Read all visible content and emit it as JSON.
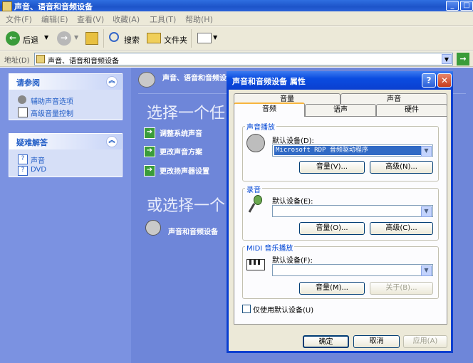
{
  "window": {
    "title": "声音、语音和音频设备"
  },
  "menu": [
    "文件(F)",
    "编辑(E)",
    "查看(V)",
    "收藏(A)",
    "工具(T)",
    "帮助(H)"
  ],
  "toolbar": {
    "back": "后退",
    "search": "搜索",
    "folders": "文件夹"
  },
  "address": {
    "label": "地址(D)",
    "value": "声音、语音和音频设备",
    "go": "→"
  },
  "see_also": {
    "title": "请参阅",
    "items": [
      "辅助声音选项",
      "高级音量控制"
    ]
  },
  "troubleshoot": {
    "title": "疑难解答",
    "items": [
      "声音",
      "DVD"
    ]
  },
  "content": {
    "header": "声音、语音和音频设备",
    "pick_task": "选择一个任",
    "tasks": [
      "调整系统声音",
      "更改声音方案",
      "更改扬声器设置"
    ],
    "or_pick": "或选择一个",
    "icon_label": "声音和音频设备"
  },
  "dialog": {
    "title": "声音和音频设备 属性",
    "tabs_top": [
      "音量",
      "声音"
    ],
    "tabs_bottom": [
      "音频",
      "语声",
      "硬件"
    ],
    "playback": {
      "title": "声音播放",
      "device_label": "默认设备(D):",
      "device_value": "Microsoft RDP 音频驱动程序",
      "volume_btn": "音量(V)...",
      "advanced_btn": "高级(N)..."
    },
    "recording": {
      "title": "录音",
      "device_label": "默认设备(E):",
      "device_value": "",
      "volume_btn": "音量(O)...",
      "advanced_btn": "高级(C)..."
    },
    "midi": {
      "title": "MIDI 音乐播放",
      "device_label": "默认设备(F):",
      "device_value": "",
      "volume_btn": "音量(M)...",
      "about_btn": "关于(B)..."
    },
    "only_default": "仅使用默认设备(U)",
    "ok": "确定",
    "cancel": "取消",
    "apply": "应用(A)"
  }
}
